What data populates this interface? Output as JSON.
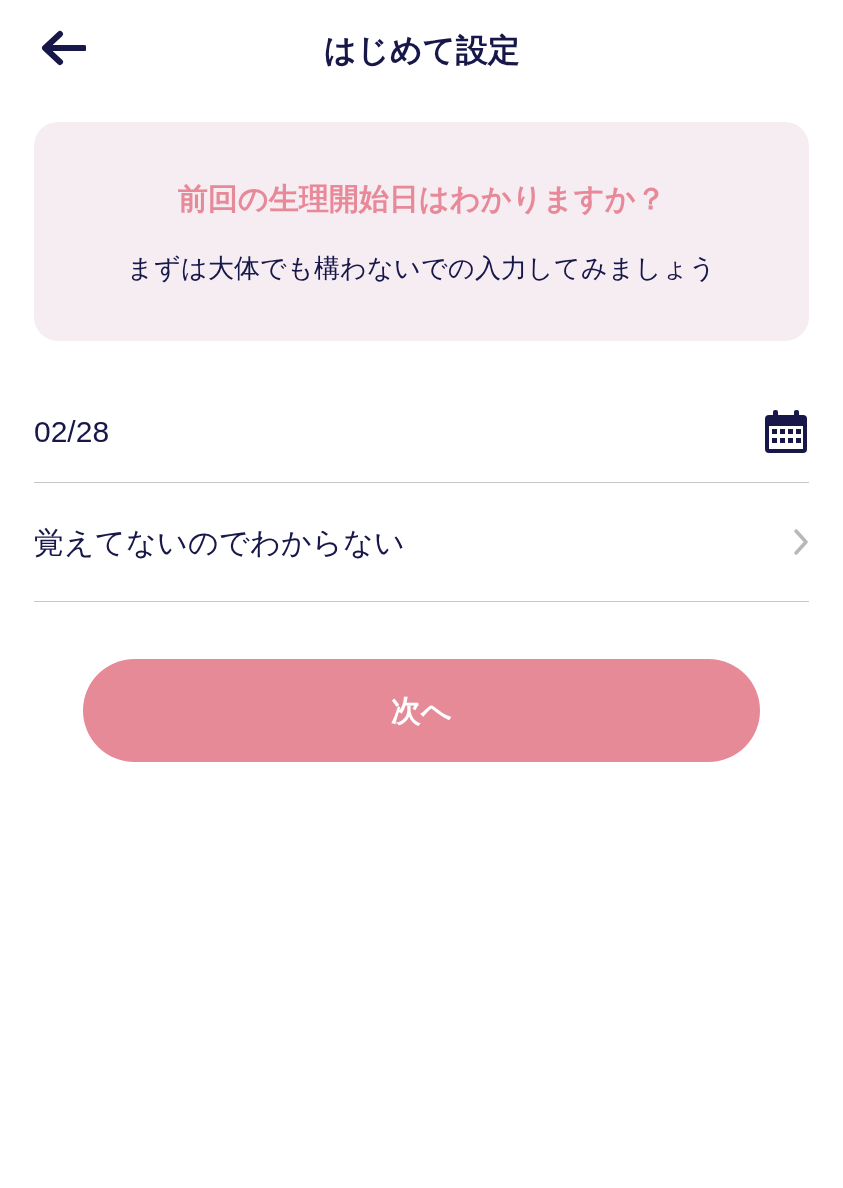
{
  "header": {
    "title": "はじめて設定"
  },
  "prompt_card": {
    "question": "前回の生理開始日はわかりますか？",
    "hint": "まずは大体でも構わないでの入力してみましょう"
  },
  "date_field": {
    "value": "02/28"
  },
  "unknown_option": {
    "label": "覚えてないのでわからない"
  },
  "next_button": {
    "label": "次へ"
  }
}
